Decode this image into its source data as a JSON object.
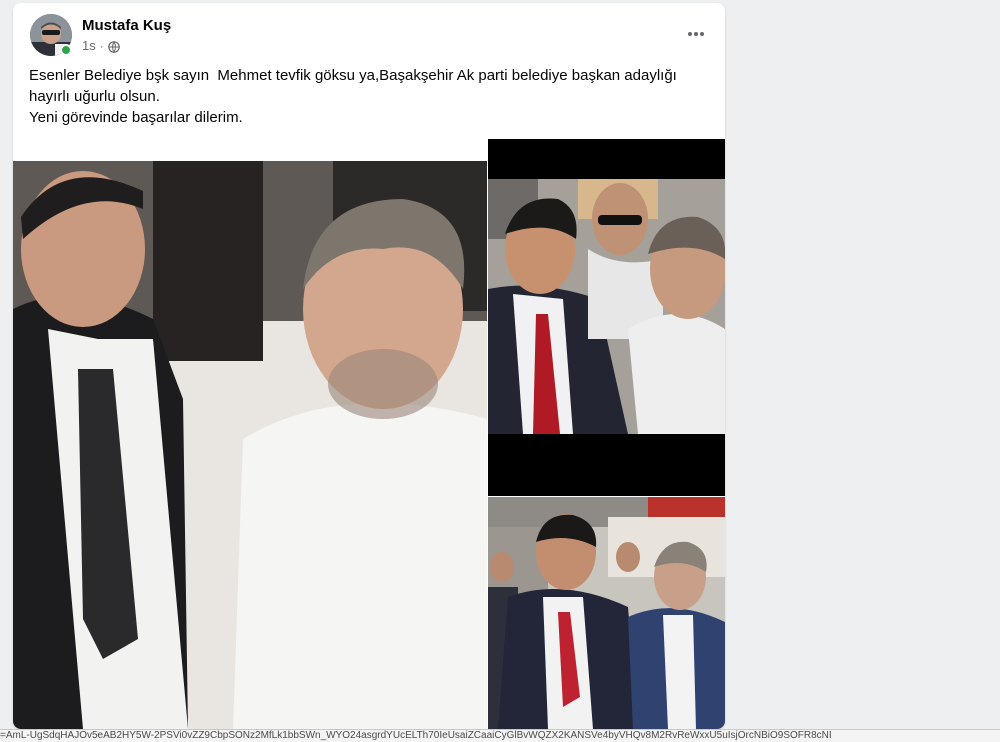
{
  "post": {
    "author_name": "Mustafa Kuş",
    "time": "1s",
    "privacy_icon": "globe-icon",
    "more_icon": "more-horizontal-icon",
    "text_lines": [
      "Esenler Belediye bşk sayın  Mehmet tevfik göksu ya,Başakşehir Ak parti belediye başkan adaylığı",
      "hayırlı uğurlu olsun.",
      "Yeni görevinde başarılar dilerim."
    ]
  },
  "photos": {
    "count": 3,
    "caption_fragment": ""
  },
  "status_bar": {
    "url_text": "=AmL-UgSdqHAJOv5eAB2HY5W-2PSVi0vZZ9CbpSONz2MfLk1bbSWn_WYO24asgrdYUcELTh70IeUsaiZCaaiCyGlBvWQZX2KANSVe4byVHQv8M2RvReWxxU5uIsjOrcNBiO9SOFR8cNI"
  },
  "colors": {
    "online": "#31a24c",
    "meta": "#65676b",
    "text": "#050505"
  }
}
